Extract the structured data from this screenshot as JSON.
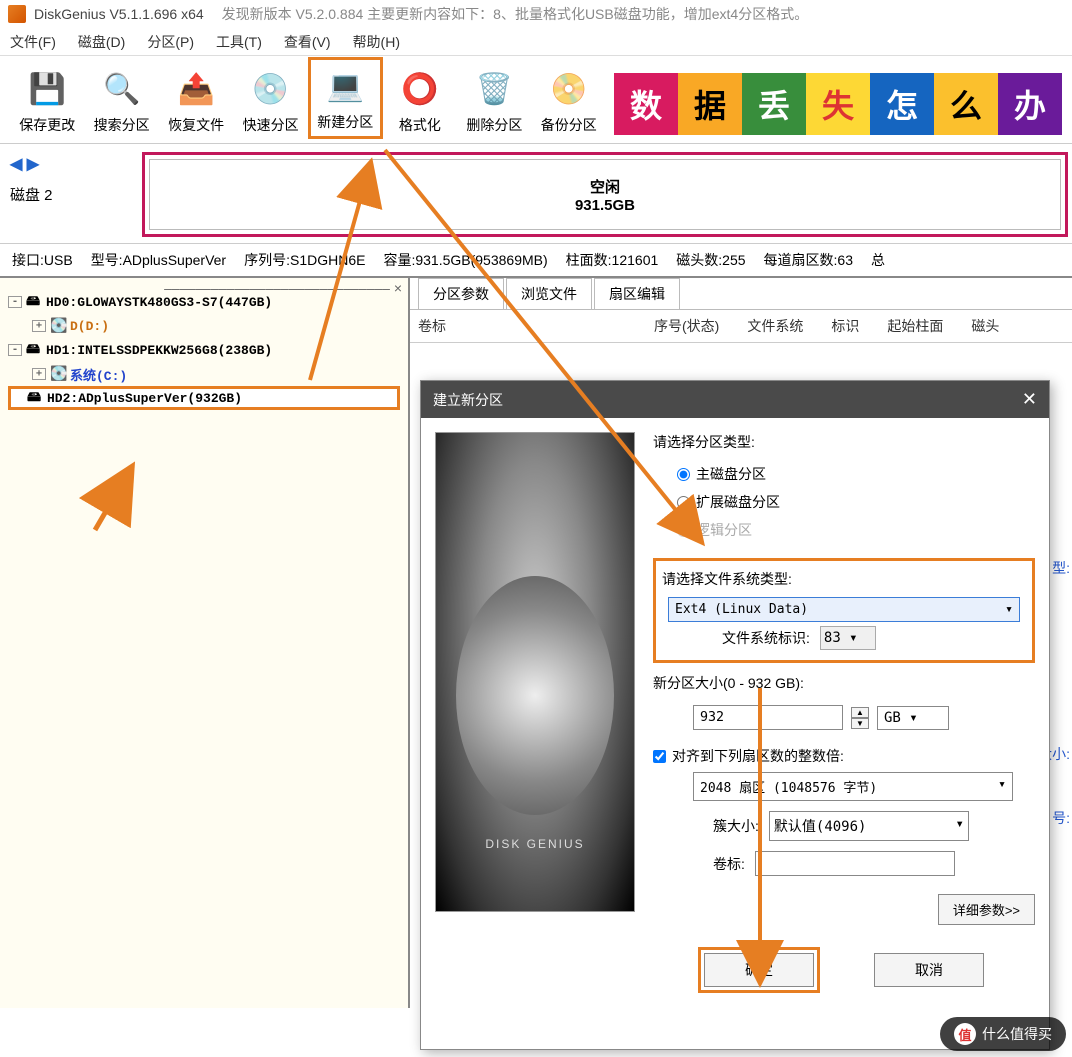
{
  "titlebar": {
    "app_title": "DiskGenius V5.1.1.696 x64",
    "update_notice": "发现新版本 V5.2.0.884 主要更新内容如下：8、批量格式化USB磁盘功能，增加ext4分区格式。"
  },
  "menu": {
    "file": "文件(F)",
    "disk": "磁盘(D)",
    "partition": "分区(P)",
    "tools": "工具(T)",
    "view": "查看(V)",
    "help": "帮助(H)"
  },
  "toolbar": {
    "save": "保存更改",
    "search": "搜索分区",
    "recover": "恢复文件",
    "quick": "快速分区",
    "newpart": "新建分区",
    "format": "格式化",
    "delete": "删除分区",
    "backup": "备份分区"
  },
  "banner": [
    "数",
    "据",
    "丢",
    "失",
    "怎",
    "么",
    "办"
  ],
  "diskbar": {
    "disk_label": "磁盘 2",
    "free_label": "空闲",
    "free_size": "931.5GB"
  },
  "infoline": {
    "interface_k": "接口:",
    "interface_v": "USB",
    "model_k": "型号:",
    "model_v": "ADplusSuperVer",
    "serial_k": "序列号:",
    "serial_v": "S1DGHN6E",
    "capacity_k": "容量:",
    "capacity_v": "931.5GB(953869MB)",
    "cyl_k": "柱面数:",
    "cyl_v": "121601",
    "heads_k": "磁头数:",
    "heads_v": "255",
    "spt_k": "每道扇区数:",
    "spt_v": "63",
    "total": "总"
  },
  "tree": {
    "hd0": "HD0:GLOWAYSTK480GS3-S7(447GB)",
    "hd0_d": "D(D:)",
    "hd1": "HD1:INTELSSDPEKKW256G8(238GB)",
    "hd1_c": "系统(C:)",
    "hd2": "HD2:ADplusSuperVer(932GB)"
  },
  "tabs": {
    "t1": "分区参数",
    "t2": "浏览文件",
    "t3": "扇区编辑"
  },
  "cols": {
    "c1": "卷标",
    "c2": "序号(状态)",
    "c3": "文件系统",
    "c4": "标识",
    "c5": "起始柱面",
    "c6": "磁头"
  },
  "side": {
    "type": "型:",
    "size": "大小:",
    "num": "号:"
  },
  "dialog": {
    "title": "建立新分区",
    "sect1": "请选择分区类型:",
    "r1": "主磁盘分区",
    "r2": "扩展磁盘分区",
    "r3": "逻辑分区",
    "sect2": "请选择文件系统类型:",
    "fs_value": "Ext4 (Linux Data)",
    "fs_id_label": "文件系统标识:",
    "fs_id_value": "83",
    "size_label": "新分区大小(0 - 932 GB):",
    "size_value": "932",
    "size_unit": "GB",
    "align_chk": "对齐到下列扇区数的整数倍:",
    "align_value": "2048 扇区 (1048576 字节)",
    "cluster_label": "簇大小:",
    "cluster_value": "默认值(4096)",
    "vol_label": "卷标:",
    "vol_value": "",
    "detail_btn": "详细参数>>",
    "ok": "确定",
    "cancel": "取消"
  },
  "watermark": {
    "text": "什么值得买",
    "badge": "值"
  }
}
